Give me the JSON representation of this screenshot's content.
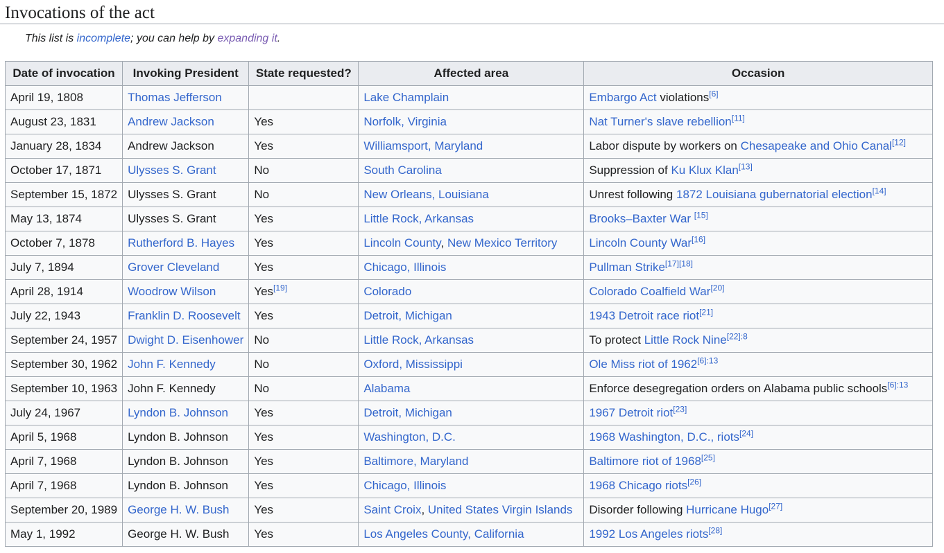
{
  "section": {
    "title": "Invocations of the act"
  },
  "hatnote": {
    "prefix": "This list is ",
    "link1": "incomplete",
    "middle": "; you can help by ",
    "link2": "expanding it",
    "suffix": "."
  },
  "table": {
    "headers": [
      "Date of invocation",
      "Invoking President",
      "State requested?",
      "Affected area",
      "Occasion"
    ],
    "rows": [
      {
        "date": "April 19, 1808",
        "president": {
          "text": "Thomas Jefferson",
          "link": true
        },
        "state": {
          "text": "",
          "sup": ""
        },
        "area": [
          {
            "text": "Lake Champlain",
            "link": true
          }
        ],
        "occasion": [
          {
            "text": "Embargo Act",
            "link": true
          },
          {
            "text": " violations",
            "link": false
          }
        ],
        "refs": "[6]"
      },
      {
        "date": "August 23, 1831",
        "president": {
          "text": "Andrew Jackson",
          "link": true
        },
        "state": {
          "text": "Yes",
          "sup": ""
        },
        "area": [
          {
            "text": "Norfolk, Virginia",
            "link": true
          }
        ],
        "occasion": [
          {
            "text": "Nat Turner's slave rebellion",
            "link": true
          }
        ],
        "refs": "[11]"
      },
      {
        "date": "January 28, 1834",
        "president": {
          "text": "Andrew Jackson",
          "link": false
        },
        "state": {
          "text": "Yes",
          "sup": ""
        },
        "area": [
          {
            "text": "Williamsport, Maryland",
            "link": true
          }
        ],
        "occasion": [
          {
            "text": "Labor dispute by workers on ",
            "link": false
          },
          {
            "text": "Chesapeake and Ohio Canal",
            "link": true
          }
        ],
        "refs": "[12]"
      },
      {
        "date": "October 17, 1871",
        "president": {
          "text": "Ulysses S. Grant",
          "link": true
        },
        "state": {
          "text": "No",
          "sup": ""
        },
        "area": [
          {
            "text": "South Carolina",
            "link": true
          }
        ],
        "occasion": [
          {
            "text": "Suppression of ",
            "link": false
          },
          {
            "text": "Ku Klux Klan",
            "link": true
          }
        ],
        "refs": "[13]"
      },
      {
        "date": "September 15, 1872",
        "president": {
          "text": "Ulysses S. Grant",
          "link": false
        },
        "state": {
          "text": "No",
          "sup": ""
        },
        "area": [
          {
            "text": "New Orleans, Louisiana",
            "link": true
          }
        ],
        "occasion": [
          {
            "text": "Unrest following ",
            "link": false
          },
          {
            "text": "1872 Louisiana gubernatorial election",
            "link": true
          }
        ],
        "refs": "[14]"
      },
      {
        "date": "May 13, 1874",
        "president": {
          "text": "Ulysses S. Grant",
          "link": false
        },
        "state": {
          "text": "Yes",
          "sup": ""
        },
        "area": [
          {
            "text": "Little Rock, Arkansas",
            "link": true
          }
        ],
        "occasion": [
          {
            "text": "Brooks–Baxter War",
            "link": true
          },
          {
            "text": " ",
            "link": false
          }
        ],
        "refs": "[15]"
      },
      {
        "date": "October 7, 1878",
        "president": {
          "text": "Rutherford B. Hayes",
          "link": true
        },
        "state": {
          "text": "Yes",
          "sup": ""
        },
        "area": [
          {
            "text": "Lincoln County",
            "link": true
          },
          {
            "text": ", ",
            "link": false
          },
          {
            "text": "New Mexico Territory",
            "link": true
          }
        ],
        "occasion": [
          {
            "text": "Lincoln County War",
            "link": true
          }
        ],
        "refs": "[16]"
      },
      {
        "date": "July 7, 1894",
        "president": {
          "text": "Grover Cleveland",
          "link": true
        },
        "state": {
          "text": "Yes",
          "sup": ""
        },
        "area": [
          {
            "text": "Chicago, Illinois",
            "link": true
          }
        ],
        "occasion": [
          {
            "text": "Pullman Strike",
            "link": true
          }
        ],
        "refs": "[17][18]"
      },
      {
        "date": "April 28, 1914",
        "president": {
          "text": "Woodrow Wilson",
          "link": true
        },
        "state": {
          "text": "Yes",
          "sup": "[19]"
        },
        "area": [
          {
            "text": "Colorado",
            "link": true
          }
        ],
        "occasion": [
          {
            "text": "Colorado Coalfield War",
            "link": true
          }
        ],
        "refs": "[20]"
      },
      {
        "date": "July 22, 1943",
        "president": {
          "text": "Franklin D. Roosevelt",
          "link": true
        },
        "state": {
          "text": "Yes",
          "sup": ""
        },
        "area": [
          {
            "text": "Detroit, Michigan",
            "link": true
          }
        ],
        "occasion": [
          {
            "text": "1943 Detroit race riot",
            "link": true
          }
        ],
        "refs": "[21]"
      },
      {
        "date": "September 24, 1957",
        "president": {
          "text": "Dwight D. Eisenhower",
          "link": true
        },
        "state": {
          "text": "No",
          "sup": ""
        },
        "area": [
          {
            "text": "Little Rock, Arkansas",
            "link": true
          }
        ],
        "occasion": [
          {
            "text": "To protect ",
            "link": false
          },
          {
            "text": "Little Rock Nine",
            "link": true
          }
        ],
        "refs": "[22]:8"
      },
      {
        "date": "September 30, 1962",
        "president": {
          "text": "John F. Kennedy",
          "link": true
        },
        "state": {
          "text": "No",
          "sup": ""
        },
        "area": [
          {
            "text": "Oxford, Mississippi",
            "link": true
          }
        ],
        "occasion": [
          {
            "text": "Ole Miss riot of 1962",
            "link": true
          }
        ],
        "refs": "[6]:13"
      },
      {
        "date": "September 10, 1963",
        "president": {
          "text": "John F. Kennedy",
          "link": false
        },
        "state": {
          "text": "No",
          "sup": ""
        },
        "area": [
          {
            "text": "Alabama",
            "link": true
          }
        ],
        "occasion": [
          {
            "text": "Enforce desegregation orders on Alabama public schools",
            "link": false
          }
        ],
        "refs": "[6]:13"
      },
      {
        "date": "July 24, 1967",
        "president": {
          "text": "Lyndon B. Johnson",
          "link": true
        },
        "state": {
          "text": "Yes",
          "sup": ""
        },
        "area": [
          {
            "text": "Detroit, Michigan",
            "link": true
          }
        ],
        "occasion": [
          {
            "text": "1967 Detroit riot",
            "link": true
          }
        ],
        "refs": "[23]"
      },
      {
        "date": "April 5, 1968",
        "president": {
          "text": "Lyndon B. Johnson",
          "link": false
        },
        "state": {
          "text": "Yes",
          "sup": ""
        },
        "area": [
          {
            "text": "Washington, D.C.",
            "link": true
          }
        ],
        "occasion": [
          {
            "text": "1968 Washington, D.C., riots",
            "link": true
          }
        ],
        "refs": "[24]"
      },
      {
        "date": "April 7, 1968",
        "president": {
          "text": "Lyndon B. Johnson",
          "link": false
        },
        "state": {
          "text": "Yes",
          "sup": ""
        },
        "area": [
          {
            "text": "Baltimore, Maryland",
            "link": true
          }
        ],
        "occasion": [
          {
            "text": "Baltimore riot of 1968",
            "link": true
          }
        ],
        "refs": "[25]"
      },
      {
        "date": "April 7, 1968",
        "president": {
          "text": "Lyndon B. Johnson",
          "link": false
        },
        "state": {
          "text": "Yes",
          "sup": ""
        },
        "area": [
          {
            "text": "Chicago, Illinois",
            "link": true
          }
        ],
        "occasion": [
          {
            "text": "1968 Chicago riots",
            "link": true
          }
        ],
        "refs": "[26]"
      },
      {
        "date": "September 20, 1989",
        "president": {
          "text": "George H. W. Bush",
          "link": true
        },
        "state": {
          "text": "Yes",
          "sup": ""
        },
        "area": [
          {
            "text": "Saint Croix",
            "link": true
          },
          {
            "text": ", ",
            "link": false
          },
          {
            "text": "United States Virgin Islands",
            "link": true
          }
        ],
        "occasion": [
          {
            "text": "Disorder following ",
            "link": false
          },
          {
            "text": "Hurricane Hugo",
            "link": true
          }
        ],
        "refs": "[27]"
      },
      {
        "date": "May 1, 1992",
        "president": {
          "text": "George H. W. Bush",
          "link": false
        },
        "state": {
          "text": "Yes",
          "sup": ""
        },
        "area": [
          {
            "text": "Los Angeles County, California",
            "link": true
          }
        ],
        "occasion": [
          {
            "text": "1992 Los Angeles riots",
            "link": true
          }
        ],
        "refs": "[28]"
      }
    ]
  }
}
